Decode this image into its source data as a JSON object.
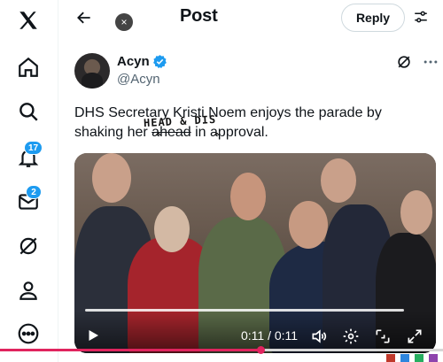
{
  "nav": {
    "items": [
      {
        "name": "x-logo-icon"
      },
      {
        "name": "home-icon"
      },
      {
        "name": "search-icon"
      },
      {
        "name": "notifications-icon",
        "badge": "17"
      },
      {
        "name": "messages-icon",
        "badge": "2"
      },
      {
        "name": "grok-icon"
      },
      {
        "name": "profile-icon"
      },
      {
        "name": "more-circle-icon"
      }
    ]
  },
  "header": {
    "title": "Post",
    "reply_label": "Reply",
    "close_glyph": "×"
  },
  "author": {
    "name": "Acyn",
    "handle": "@Acyn"
  },
  "tweet": {
    "line1": "DHS Secretary Kristi Noem enjoys the parade by",
    "line2_a": "shaking her ",
    "line2_b": "ahead",
    "line2_c": " in approval.",
    "annotation": "HEAD & DIS"
  },
  "video": {
    "time": "0:11 / 0:11",
    "progress": 1.0
  },
  "page_scrub_progress": 0.59,
  "colors": {
    "accent": "#1d9bf0",
    "scrub": "#e0245e"
  }
}
